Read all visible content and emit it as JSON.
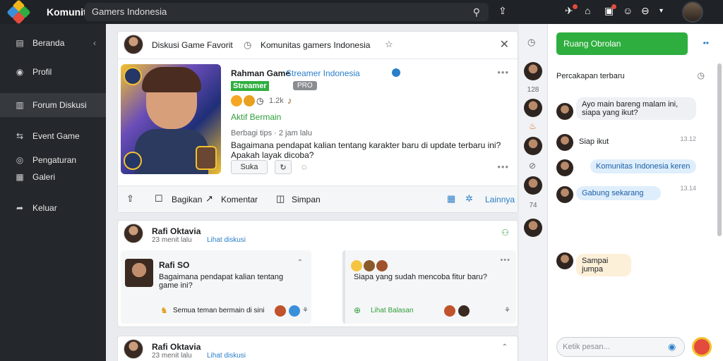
{
  "topbar": {
    "title": "Komunitas",
    "subtitle": "Gamers Indonesia"
  },
  "sidebar": {
    "items": [
      {
        "label": "Beranda"
      },
      {
        "label": "Profil"
      },
      {
        "label": "Forum Diskusi"
      },
      {
        "label": "Event Game"
      },
      {
        "label": "Pengaturan"
      },
      {
        "label": "Galeri"
      },
      {
        "label": "Keluar"
      }
    ]
  },
  "post_header": {
    "text": "Diskusi Game Favorit",
    "tag": "Komunitas gamers Indonesia"
  },
  "post": {
    "author": "Rahman Game",
    "author_note": "Streamer Indonesia",
    "badge": "Streamer",
    "badge2": "PRO",
    "reactions": "1.2k",
    "status": "Aktif Bermain",
    "meta": "Berbagi tips · 2 jam lalu",
    "body": "Bagaimana pendapat kalian tentang karakter baru di update terbaru ini? Apakah layak dicoba?",
    "like_btn": "Suka",
    "actions": {
      "share": "Bagikan",
      "comment": "Komentar",
      "save": "Simpan",
      "more": "Lainnya"
    }
  },
  "post2": {
    "author": "Rafi Oktavia",
    "meta": "23 menit lalu",
    "link": "Lihat diskusi",
    "cols": [
      {
        "title": "Rafi SO",
        "body": "Bagaimana pendapat kalian tentang game ini?",
        "footer": "Semua teman bermain di sini"
      },
      {
        "title": "",
        "body": "Siapa yang sudah mencoba fitur baru?",
        "footer": "Lihat Balasan"
      }
    ]
  },
  "post3": {
    "author": "Rafi Oktavia",
    "meta": "23 menit lalu",
    "link": "Lihat diskusi"
  },
  "strip": {
    "counts": [
      "128",
      "74"
    ]
  },
  "chat": {
    "button": "Ruang Obrolan",
    "header": "Percakapan terbaru",
    "messages": [
      {
        "text": "Ayo main bareng malam ini, siapa yang ikut?",
        "time": ""
      },
      {
        "text": "Siap ikut",
        "time": "13.12"
      },
      {
        "text": "Komunitas Indonesia keren",
        "time": ""
      },
      {
        "text": "Gabung sekarang",
        "time": "13.14"
      },
      {
        "text": "Sampai jumpa",
        "time": ""
      }
    ],
    "input_placeholder": "Ketik pesan..."
  }
}
